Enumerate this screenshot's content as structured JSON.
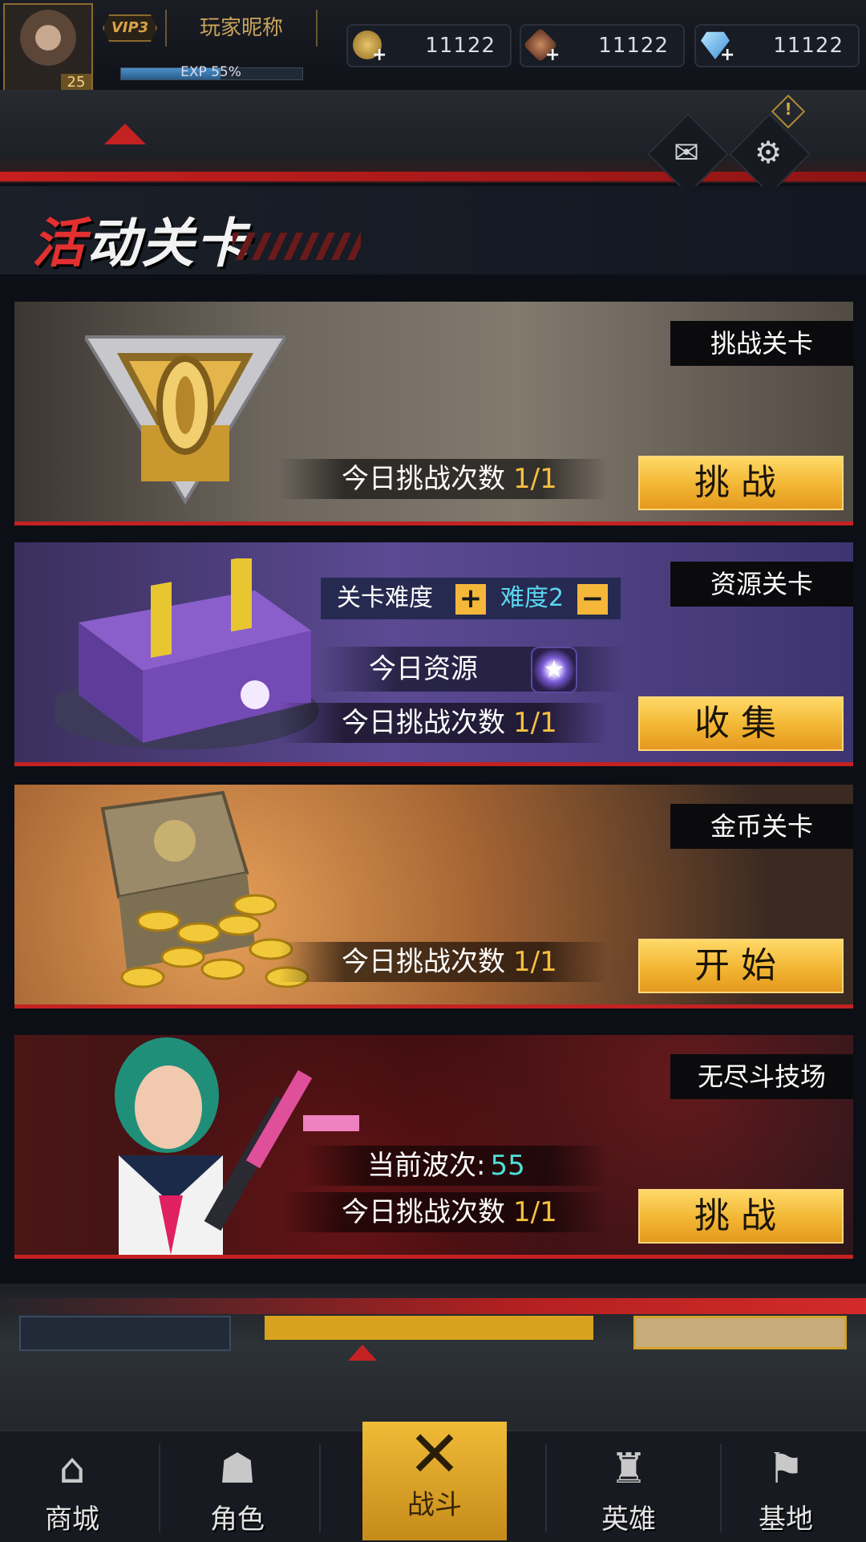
{
  "player": {
    "vip": "VIP3",
    "nickname": "玩家昵称",
    "level": "25",
    "exp_text": "EXP 55%",
    "exp_fraction": 0.55
  },
  "currencies": [
    {
      "icon": "gold-coin-icon",
      "value": "11122"
    },
    {
      "icon": "bronze-token-icon",
      "value": "11122"
    },
    {
      "icon": "diamond-icon",
      "value": "11122"
    }
  ],
  "header": {
    "mail_icon": "mail-icon",
    "settings_icon": "gear-icon",
    "alert_mark": "!"
  },
  "page_title": "活动关卡",
  "cards": {
    "challenge": {
      "badge": "挑战关卡",
      "count_label": "今日挑战次数",
      "count_value": "1/1",
      "button": "挑战"
    },
    "resource": {
      "badge": "资源关卡",
      "difficulty_label": "关卡难度",
      "difficulty_value": "难度2",
      "plus": "+",
      "minus": "−",
      "resource_label": "今日资源",
      "resource_icon": "★",
      "count_label": "今日挑战次数",
      "count_value": "1/1",
      "button": "收集"
    },
    "gold": {
      "badge": "金币关卡",
      "count_label": "今日挑战次数",
      "count_value": "1/1",
      "button": "开始"
    },
    "arena": {
      "badge": "无尽斗技场",
      "wave_label": "当前波次:",
      "wave_value": "55",
      "count_label": "今日挑战次数",
      "count_value": "1/1",
      "button": "挑战"
    }
  },
  "nav": [
    {
      "label": "商城",
      "icon": "shop-icon",
      "glyph": "⌂"
    },
    {
      "label": "角色",
      "icon": "helmet-icon",
      "glyph": "☗"
    },
    {
      "label": "战斗",
      "icon": "crossed-guns-icon",
      "glyph": "✕",
      "active": true
    },
    {
      "label": "英雄",
      "icon": "hero-icon",
      "glyph": "♜"
    },
    {
      "label": "基地",
      "icon": "flag-icon",
      "glyph": "⚑"
    }
  ],
  "colors": {
    "accent_red": "#c42222",
    "button_gold": "#f2b533",
    "count_yellow": "#f4c040",
    "difficulty_cyan": "#5ad8f0",
    "wave_cyan": "#4ee0d8"
  }
}
